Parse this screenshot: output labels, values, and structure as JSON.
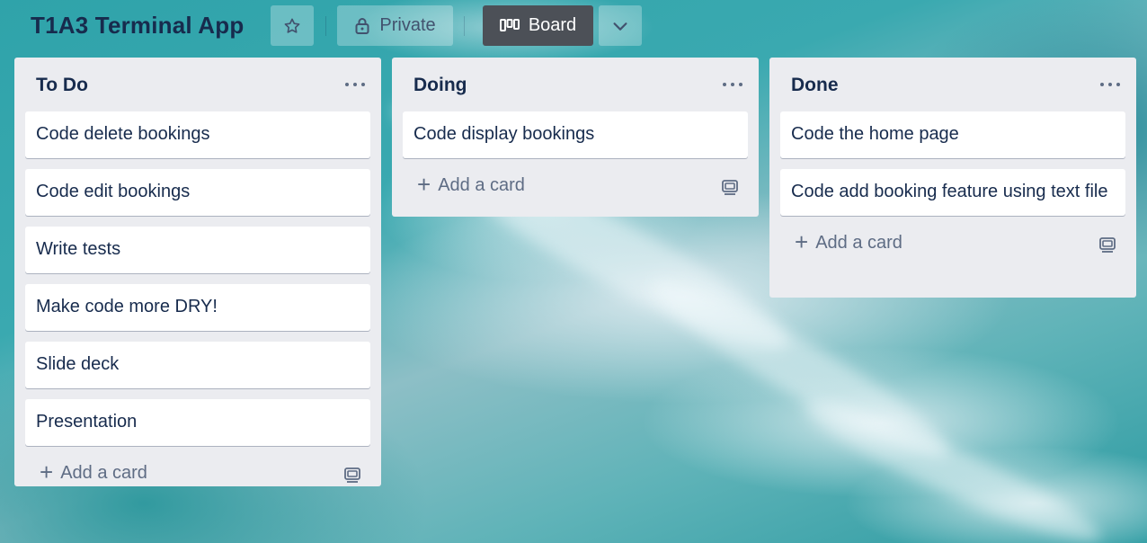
{
  "board": {
    "title": "T1A3 Terminal App",
    "visibility_label": "Private",
    "view_label": "Board"
  },
  "lists": [
    {
      "title": "To Do",
      "cards": [
        "Code delete bookings",
        "Code edit bookings",
        "Write tests",
        "Make code more DRY!",
        "Slide deck",
        "Presentation"
      ],
      "add_label": "Add a card"
    },
    {
      "title": "Doing",
      "cards": [
        "Code display bookings"
      ],
      "add_label": "Add a card"
    },
    {
      "title": "Done",
      "cards": [
        "Code the home page",
        "Code add booking feature using text file"
      ],
      "add_label": "Add a card"
    }
  ],
  "icons": {
    "star": "star-icon",
    "lock": "lock-icon",
    "board": "board-icon",
    "chevron": "chevron-down-icon",
    "list_menu": "more-icon",
    "add": "plus-icon",
    "template": "card-template-icon"
  },
  "colors": {
    "list_bg": "#ebecf0",
    "card_bg": "#ffffff",
    "text": "#172b4d",
    "muted": "#5e6c84",
    "active_button": "#4c5057"
  }
}
